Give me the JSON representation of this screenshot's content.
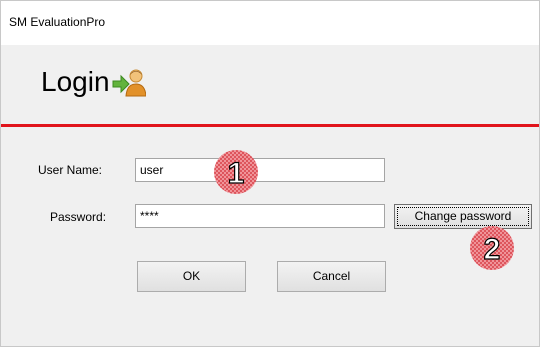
{
  "window": {
    "title": "SM EvaluationPro"
  },
  "header": {
    "heading": "Login",
    "icon": "user-login-icon"
  },
  "form": {
    "username_label": "User Name:",
    "username_value": "user",
    "password_label": "Password:",
    "password_value": "****",
    "change_password_label": "Change password",
    "ok_label": "OK",
    "cancel_label": "Cancel"
  },
  "annotations": {
    "marker1": "1",
    "marker2": "2"
  },
  "colors": {
    "accent_line": "#e1141c",
    "marker": "#d9444c"
  }
}
